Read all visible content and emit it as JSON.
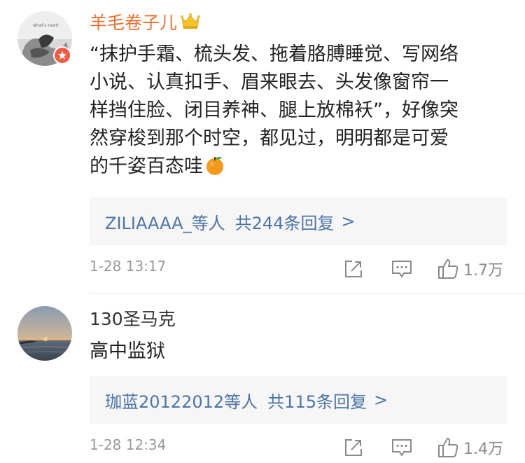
{
  "comments": [
    {
      "username": "羊毛卷子儿",
      "is_vip": true,
      "avatar_icon": "sketch-portrait-avatar",
      "badge_icon": "verified-v-badge",
      "text_lines": [
        "“抹护手霜、梳头发、拖着胳膊睡觉、写网络",
        "小说、认真扣手、眉来眼去、头发像窗帘一",
        "样挡住脸、闭目养神、腿上放棉袄”，好像突",
        "然穿梭到那个时空，都见过，明明都是可爱",
        "的千姿百态哇"
      ],
      "emoji": "orange-emoji",
      "reply_summary": {
        "users": "ZILIAAAA_等人",
        "count_text": "共244条回复",
        "arrow": ">"
      },
      "timestamp": "1-28 13:17",
      "likes": "1.7万"
    },
    {
      "username": "130圣马克",
      "is_vip": false,
      "avatar_icon": "sunset-sea-avatar",
      "text_lines": [
        "高中监狱"
      ],
      "reply_summary": {
        "users": "珈蓝20122012等人",
        "count_text": "共115条回复",
        "arrow": ">"
      },
      "timestamp": "1-28 12:34",
      "likes": "1.4万"
    }
  ],
  "colors": {
    "vip_name": "#f26d2b",
    "link_blue": "#4b75a8",
    "reply_bg": "#f6f6f6",
    "meta_gray": "#9a9a9a"
  }
}
